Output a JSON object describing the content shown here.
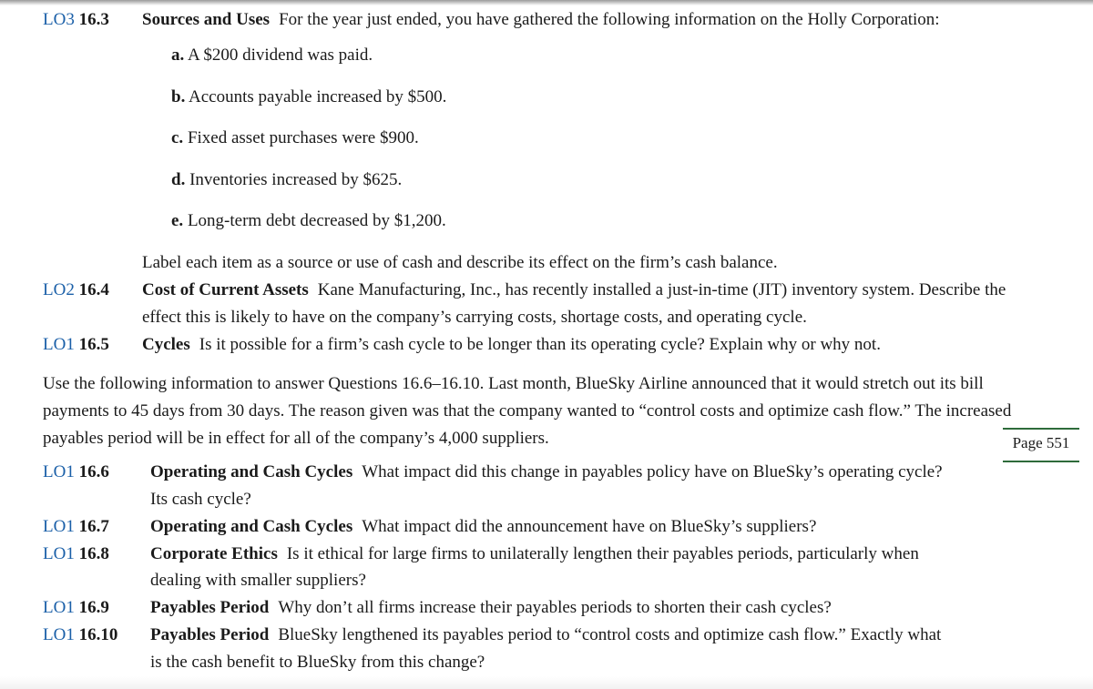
{
  "problems": [
    {
      "lo": "LO3",
      "number": "16.3",
      "title": "Sources and Uses",
      "lines": [
        "For the year just ended, you have gathered the following information on the Holly Corporation:"
      ],
      "items": [
        {
          "label": "a.",
          "text": "A $200 dividend was paid."
        },
        {
          "label": "b.",
          "text": "Accounts payable increased by $500."
        },
        {
          "label": "c.",
          "text": "Fixed asset purchases were $900."
        },
        {
          "label": "d.",
          "text": "Inventories increased by $625."
        },
        {
          "label": "e.",
          "text": "Long-term debt decreased by $1,200."
        }
      ],
      "after": "Label each item as a source or use of cash and describe its effect on the firm’s cash balance."
    },
    {
      "lo": "LO2",
      "number": "16.4",
      "title": "Cost of Current Assets",
      "lines": [
        "Kane Manufacturing, Inc., has recently installed a just-in-time (JIT) inventory system. Describe the",
        "effect this is likely to have on the company’s carrying costs, shortage costs, and operating cycle."
      ]
    },
    {
      "lo": "LO1",
      "number": "16.5",
      "title": "Cycles",
      "lines": [
        "Is it possible for a firm’s cash cycle to be longer than its operating cycle? Explain why or why not."
      ]
    }
  ],
  "intro": [
    "Use the following information to answer Questions 16.6–16.10. Last month, BlueSky Airline announced that it would stretch out its bill",
    "payments to 45 days from 30 days. The reason given was that the company wanted to “control costs and optimize cash flow.” The increased",
    "payables period will be in effect for all of the company’s 4,000 suppliers."
  ],
  "page_marker": "Page 551",
  "problems2": [
    {
      "lo": "LO1",
      "number": "16.6",
      "title": "Operating and Cash Cycles",
      "lines": [
        "What impact did this change in payables policy have on BlueSky’s operating cycle?",
        "Its cash cycle?"
      ]
    },
    {
      "lo": "LO1",
      "number": "16.7",
      "title": "Operating and Cash Cycles",
      "lines": [
        "What impact did the announcement have on BlueSky’s suppliers?"
      ]
    },
    {
      "lo": "LO1",
      "number": "16.8",
      "title": "Corporate Ethics",
      "lines": [
        "Is it ethical for large firms to unilaterally lengthen their payables periods, particularly when",
        "dealing with smaller suppliers?"
      ]
    },
    {
      "lo": "LO1",
      "number": "16.9",
      "title": "Payables Period",
      "lines": [
        "Why don’t all firms increase their payables periods to shorten their cash cycles?"
      ]
    },
    {
      "lo": "LO1",
      "number": "16.10",
      "title": "Payables Period",
      "lines": [
        "BlueSky lengthened its payables period to “control costs and optimize cash flow.” Exactly what",
        "is the cash benefit to BlueSky from this change?"
      ]
    }
  ]
}
